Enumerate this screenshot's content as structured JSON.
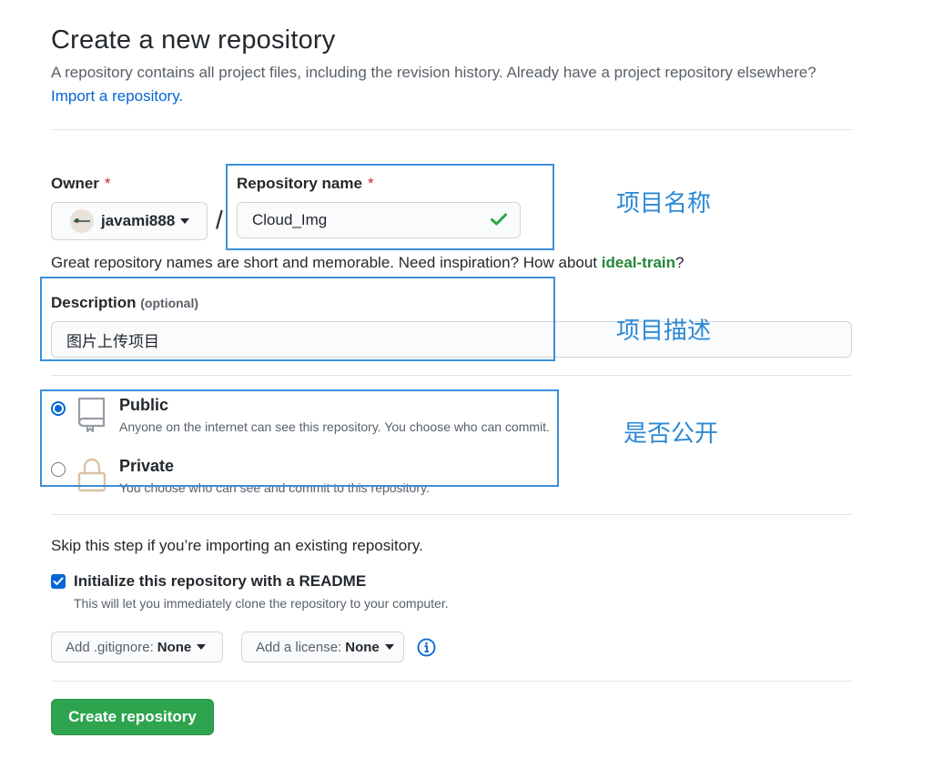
{
  "header": {
    "title": "Create a new repository",
    "subtitle": "A repository contains all project files, including the revision history. Already have a project repository elsewhere?",
    "import_link": "Import a repository."
  },
  "owner": {
    "label": "Owner",
    "required_mark": "*",
    "value": "javami888"
  },
  "separator": "/",
  "repo_name": {
    "label": "Repository name",
    "required_mark": "*",
    "value": "Cloud_Img"
  },
  "hint": {
    "prefix": "Great repository names are short and memorable. Need inspiration? How about ",
    "suggestion": "ideal-train",
    "suffix": "?"
  },
  "description": {
    "label": "Description",
    "optional": "(optional)",
    "value": "图片上传项目"
  },
  "visibility": {
    "public": {
      "title": "Public",
      "desc": "Anyone on the internet can see this repository. You choose who can commit.",
      "selected": true
    },
    "private": {
      "title": "Private",
      "desc": "You choose who can see and commit to this repository.",
      "selected": false
    }
  },
  "init": {
    "skip_text": "Skip this step if you’re importing an existing repository.",
    "readme_label": "Initialize this repository with a README",
    "readme_desc": "This will let you immediately clone the repository to your computer.",
    "readme_checked": true
  },
  "gitignore": {
    "label": "Add .gitignore:",
    "value": "None"
  },
  "license": {
    "label": "Add a license:",
    "value": "None"
  },
  "create_button": "Create repository",
  "annotations": {
    "name": "项目名称",
    "desc": "项目描述",
    "visibility": "是否公开"
  },
  "colors": {
    "link": "#0366d6",
    "primary_button": "#2ea44f",
    "required": "#cb2431",
    "suggestion": "#22863a",
    "annotation": "#2b89d6"
  }
}
